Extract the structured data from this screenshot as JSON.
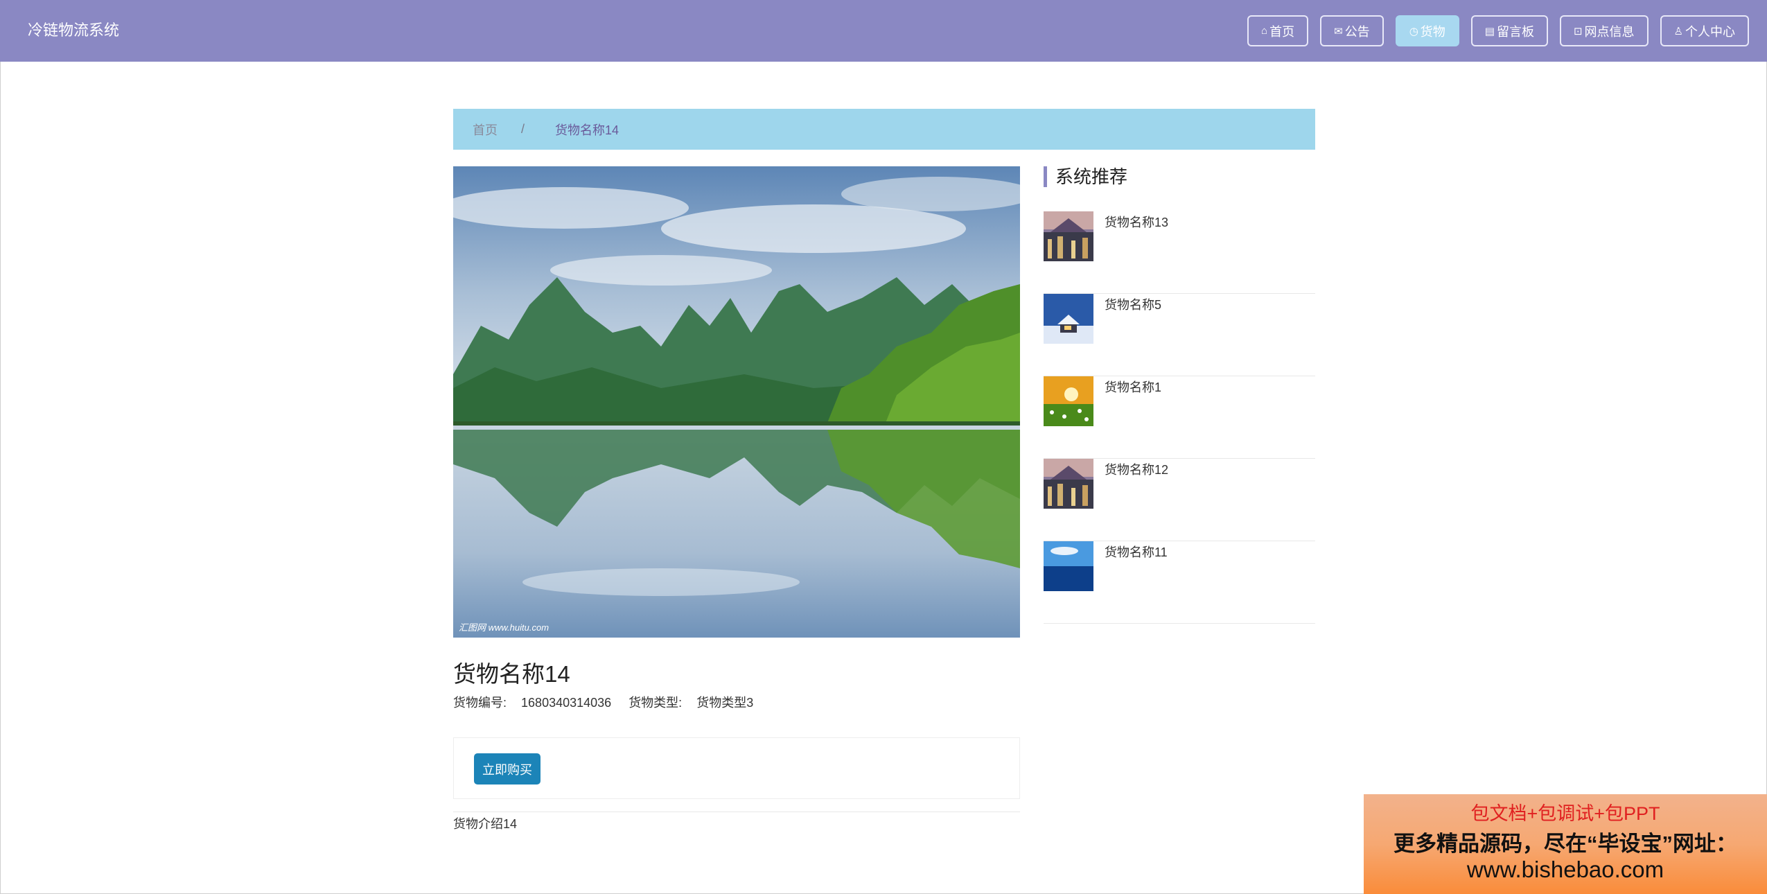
{
  "header": {
    "brand": "冷链物流系统",
    "nav": [
      {
        "icon": "home-icon",
        "glyph": "⌂",
        "label": "首页"
      },
      {
        "icon": "mail-icon",
        "glyph": "✉",
        "label": "公告"
      },
      {
        "icon": "goods-icon",
        "glyph": "◷",
        "label": "货物",
        "active": true
      },
      {
        "icon": "board-icon",
        "glyph": "▤",
        "label": "留言板"
      },
      {
        "icon": "branch-icon",
        "glyph": "⊡",
        "label": "网点信息"
      },
      {
        "icon": "user-icon",
        "glyph": "♙",
        "label": "个人中心"
      }
    ]
  },
  "breadcrumb": {
    "home": "首页",
    "separator": "/",
    "current": "货物名称14"
  },
  "goods": {
    "image_watermark": "汇图网 www.huitu.com",
    "title": "货物名称14",
    "number_label": "货物编号:",
    "number_value": "1680340314036",
    "type_label": "货物类型:",
    "type_value": "货物类型3",
    "buy_label": "立即购买",
    "description": "货物介绍14"
  },
  "recommend": {
    "title": "系统推荐",
    "items": [
      {
        "name": "货物名称13",
        "thumb": "city"
      },
      {
        "name": "货物名称5",
        "thumb": "snow"
      },
      {
        "name": "货物名称1",
        "thumb": "sunset"
      },
      {
        "name": "货物名称12",
        "thumb": "city"
      },
      {
        "name": "货物名称11",
        "thumb": "sea"
      }
    ]
  },
  "ad": {
    "line1": "包文档+包调试+包PPT",
    "line2": "更多精品源码，尽在“毕设宝”网址：",
    "line3": "www.bishebao.com"
  },
  "colors": {
    "header": "#8a88c3",
    "breadcrumb": "#9ed6ec",
    "buy_button": "#1c84b8",
    "active_nav": "#a8d8f0"
  }
}
